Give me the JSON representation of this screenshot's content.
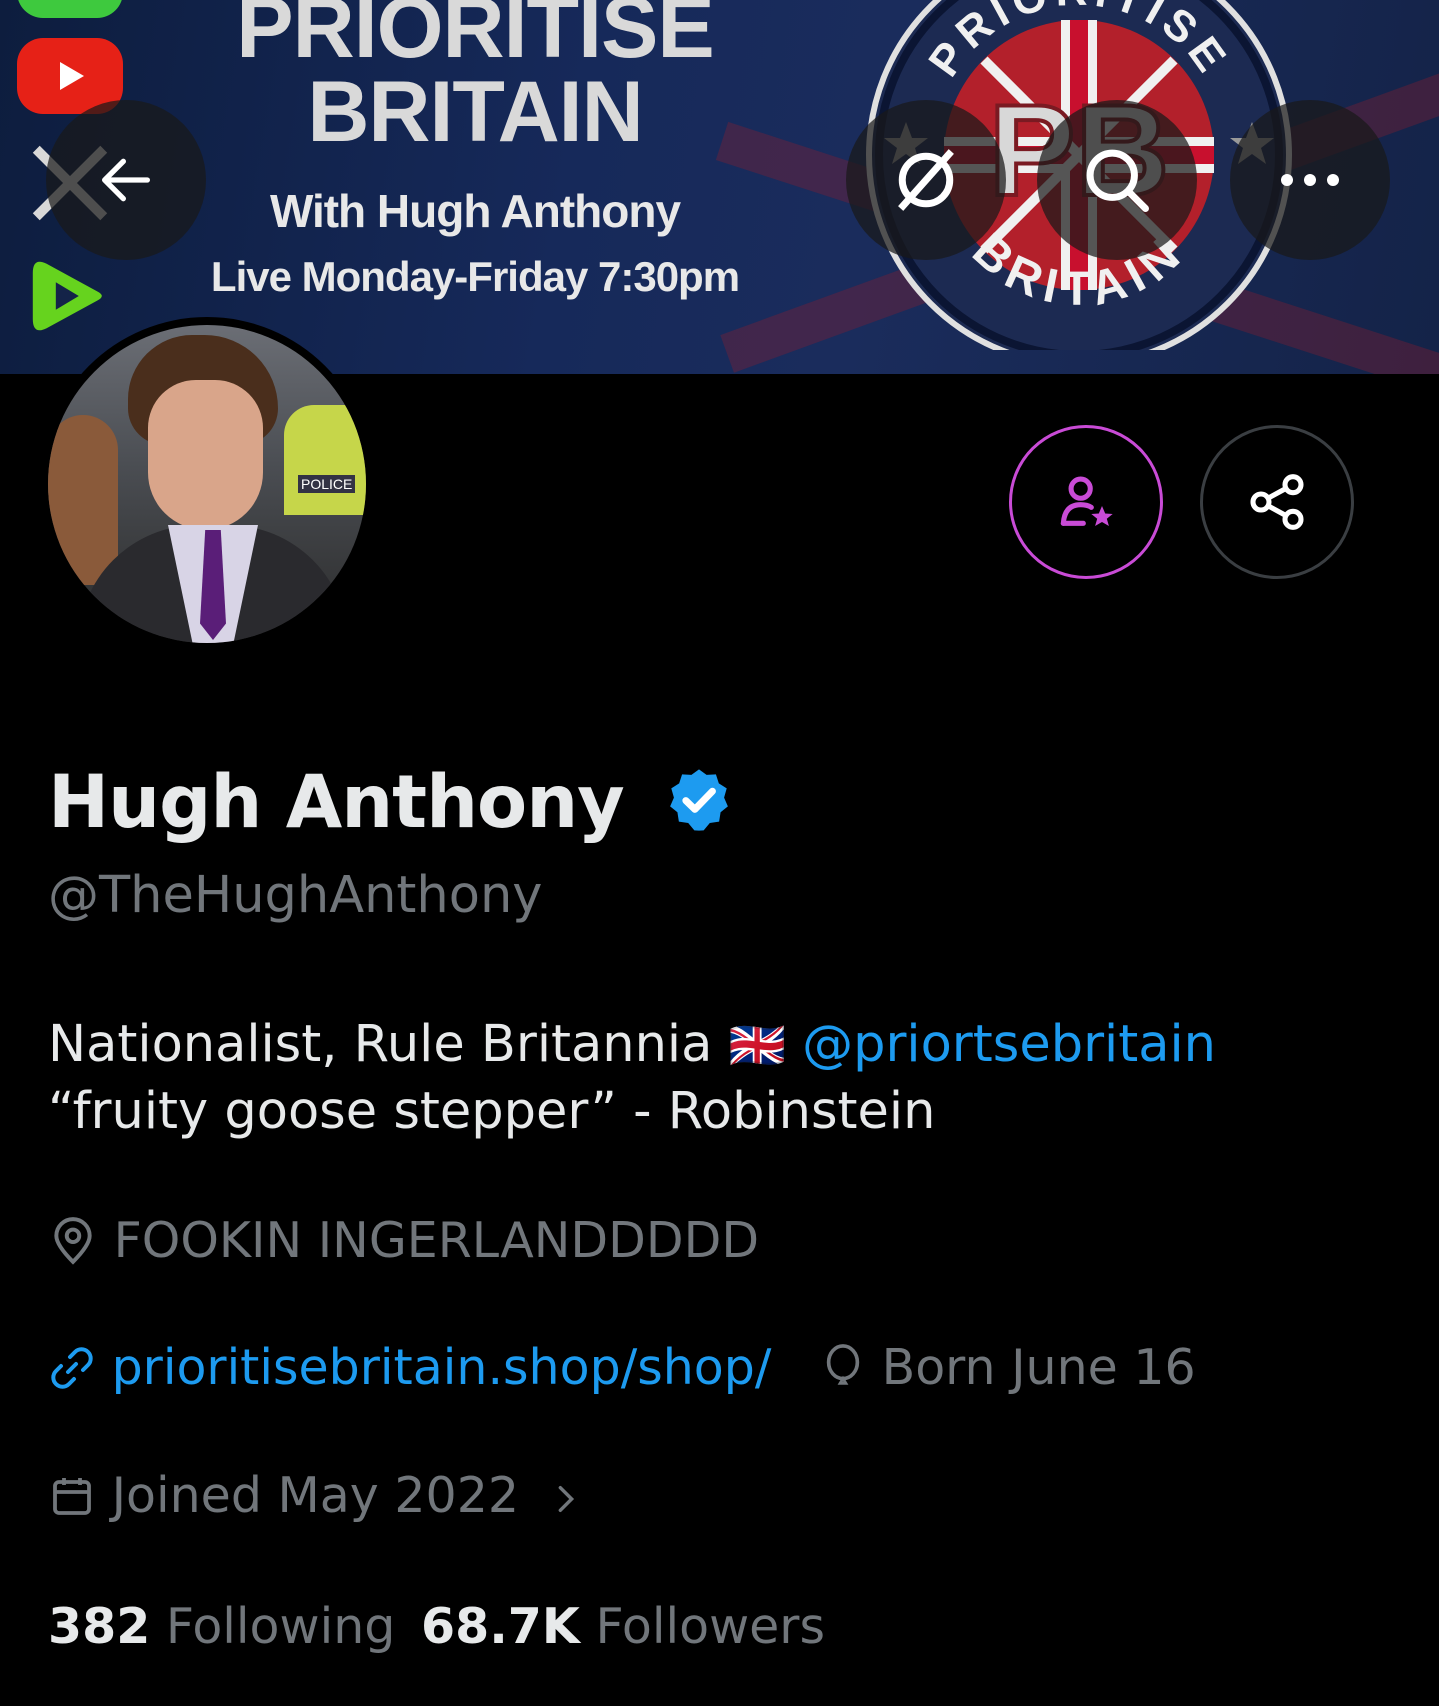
{
  "banner": {
    "title_line1": "PRIORITISE",
    "title_line2": "BRITAIN",
    "subtitle": "With Hugh Anthony",
    "schedule": "Live Monday-Friday 7:30pm",
    "logo_letters": "PB",
    "logo_ring_top": "PRIORITISE",
    "logo_ring_bottom": "BRITAIN",
    "social_icons": [
      "youtube-icon",
      "x-icon",
      "rumble-icon"
    ]
  },
  "top_nav": {
    "back_icon": "arrow-left-icon",
    "grok_icon": "grok-icon",
    "search_icon": "search-icon",
    "more_icon": "more-icon"
  },
  "avatar": {
    "badge_text": "POLICE"
  },
  "actions": {
    "subscribe_icon": "user-star-icon",
    "share_icon": "share-icon",
    "accent_color": "#c94bd6"
  },
  "profile": {
    "name": "Hugh Anthony",
    "handle": "@TheHughAnthony",
    "verified_color": "#1d9bf0",
    "bio_line1_text": "Nationalist, Rule Britannia",
    "bio_line1_emoji": "🇬🇧",
    "bio_line1_mention": "@priortsebritain",
    "bio_line2": "“fruity goose stepper” - Robinstein",
    "location": "FOOKIN INGERLANDDDDD",
    "website": "prioritisebritain.shop/shop/",
    "birthday": "Born June 16",
    "joined": "Joined May 2022",
    "following_count": "382",
    "following_label": "Following",
    "followers_count": "68.7K",
    "followers_label": "Followers"
  },
  "colors": {
    "background": "#000000",
    "primary_text": "#e7e9ea",
    "secondary_text": "#71767b",
    "link": "#1d9bf0"
  }
}
